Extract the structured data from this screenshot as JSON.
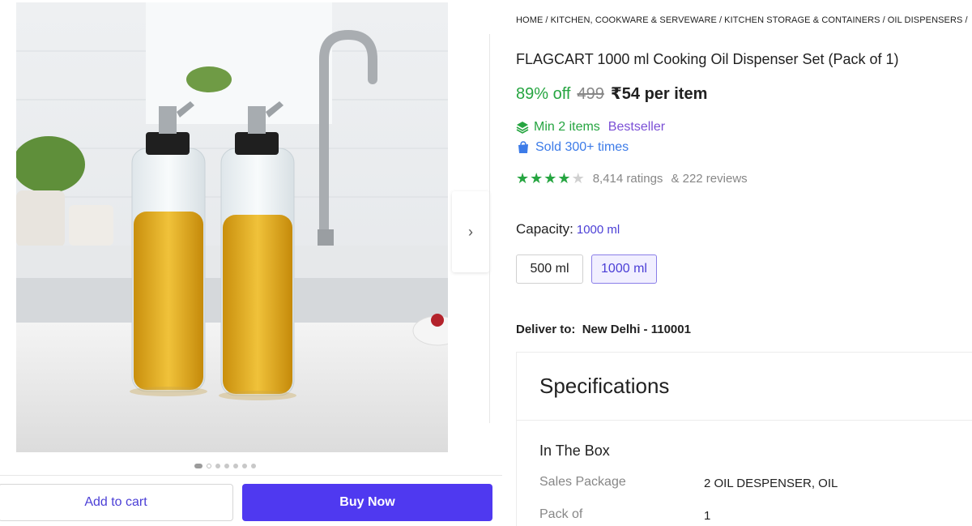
{
  "breadcrumb": [
    "HOME",
    "KITCHEN, COOKWARE & SERVEWARE",
    "KITCHEN STORAGE & CONTAINERS",
    "OIL DISPENSERS"
  ],
  "breadcrumb_separator": "/",
  "product": {
    "title": "FLAGCART 1000 ml Cooking Oil Dispenser Set (Pack of 1)",
    "discount": "89% off",
    "mrp": "499",
    "price": "₹54 per item",
    "min_items": "Min 2 items",
    "bestseller": "Bestseller",
    "sold": "Sold 300+ times",
    "rating_stars": 4,
    "rating_max": 5,
    "ratings_text": "8,414 ratings",
    "reviews_text": "& 222 reviews"
  },
  "capacity": {
    "label": "Capacity:",
    "selected": "1000 ml",
    "options": [
      "500 ml",
      "1000 ml"
    ]
  },
  "delivery": {
    "label": "Deliver to:",
    "location": "New Delhi - 110001"
  },
  "specs": {
    "heading": "Specifications",
    "section": "In The Box",
    "rows": [
      {
        "key": "Sales Package",
        "value": "2 OIL DESPENSER, OIL"
      },
      {
        "key": "Pack of",
        "value": "1"
      }
    ]
  },
  "actions": {
    "add_to_cart": "Add to cart",
    "buy_now": "Buy Now"
  },
  "gallery": {
    "image_count": 7,
    "active_index": 0
  },
  "colors": {
    "accent": "#4f39f0",
    "discount_green": "#26a541",
    "info_blue": "#3c7be8"
  }
}
